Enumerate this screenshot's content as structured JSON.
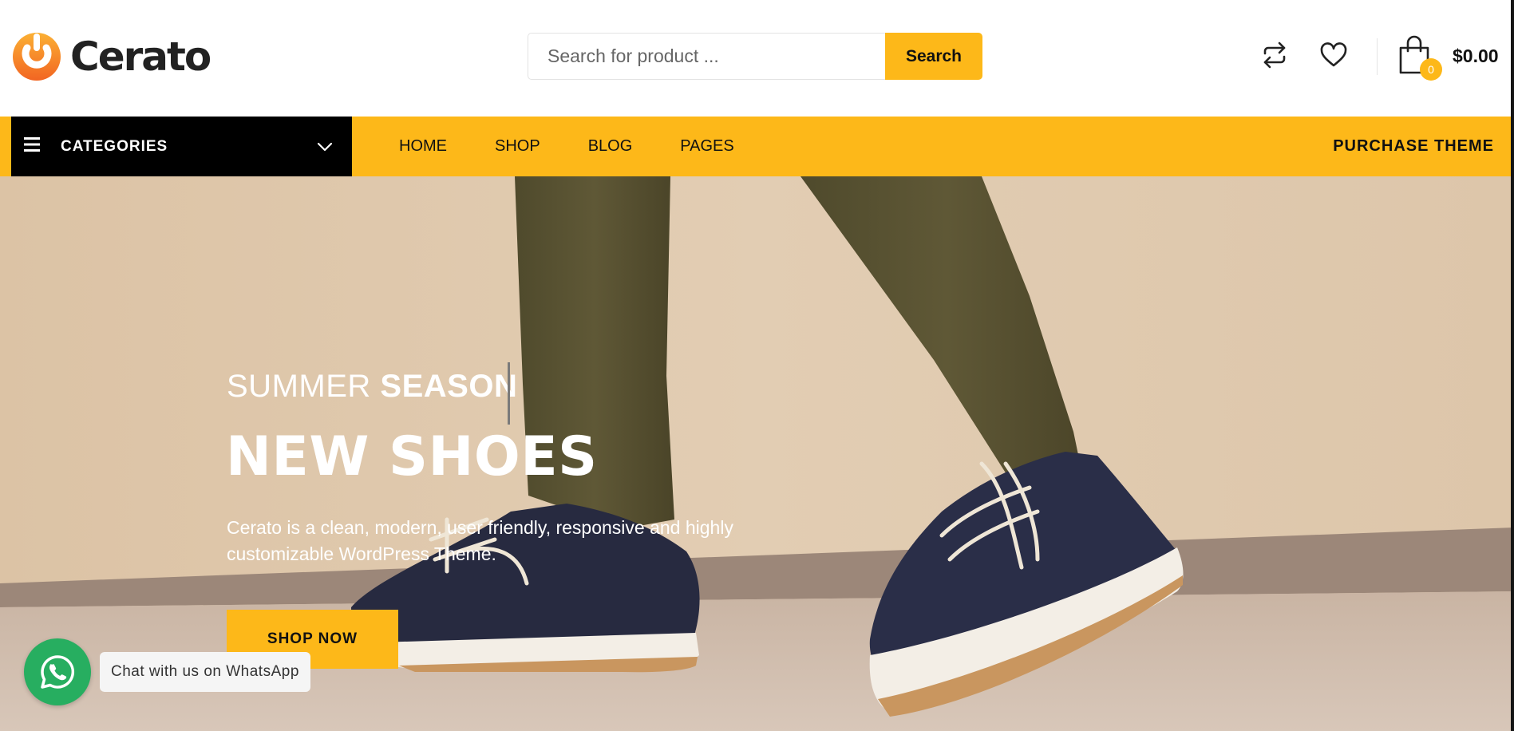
{
  "header": {
    "logo_text": "Cerato",
    "search": {
      "placeholder": "Search for product ...",
      "value": "",
      "button_label": "Search"
    },
    "cart": {
      "count": "0",
      "total": "$0.00"
    }
  },
  "nav": {
    "categories_label": "CATEGORIES",
    "items": [
      {
        "label": "HOME"
      },
      {
        "label": "SHOP"
      },
      {
        "label": "BLOG"
      },
      {
        "label": "PAGES"
      }
    ],
    "purchase_label": "PURCHASE THEME"
  },
  "hero": {
    "eyebrow_light": "SUMMER",
    "eyebrow_bold": "SEASON",
    "title": "NEW SHOES",
    "description": "Cerato is a clean, modern, user friendly, responsive and highly customizable WordPress Theme.",
    "cta_label": "SHOP NOW"
  },
  "whatsapp": {
    "label": "Chat with us on WhatsApp"
  },
  "colors": {
    "accent": "#fdb819",
    "nav_dark": "#000000",
    "logo_orange": "#f7941d",
    "whatsapp_green": "#27ae60"
  },
  "icons": [
    "logo-icon",
    "compare-icon",
    "heart-icon",
    "shopping-bag-icon",
    "hamburger-icon",
    "chevron-down-icon",
    "whatsapp-icon"
  ]
}
